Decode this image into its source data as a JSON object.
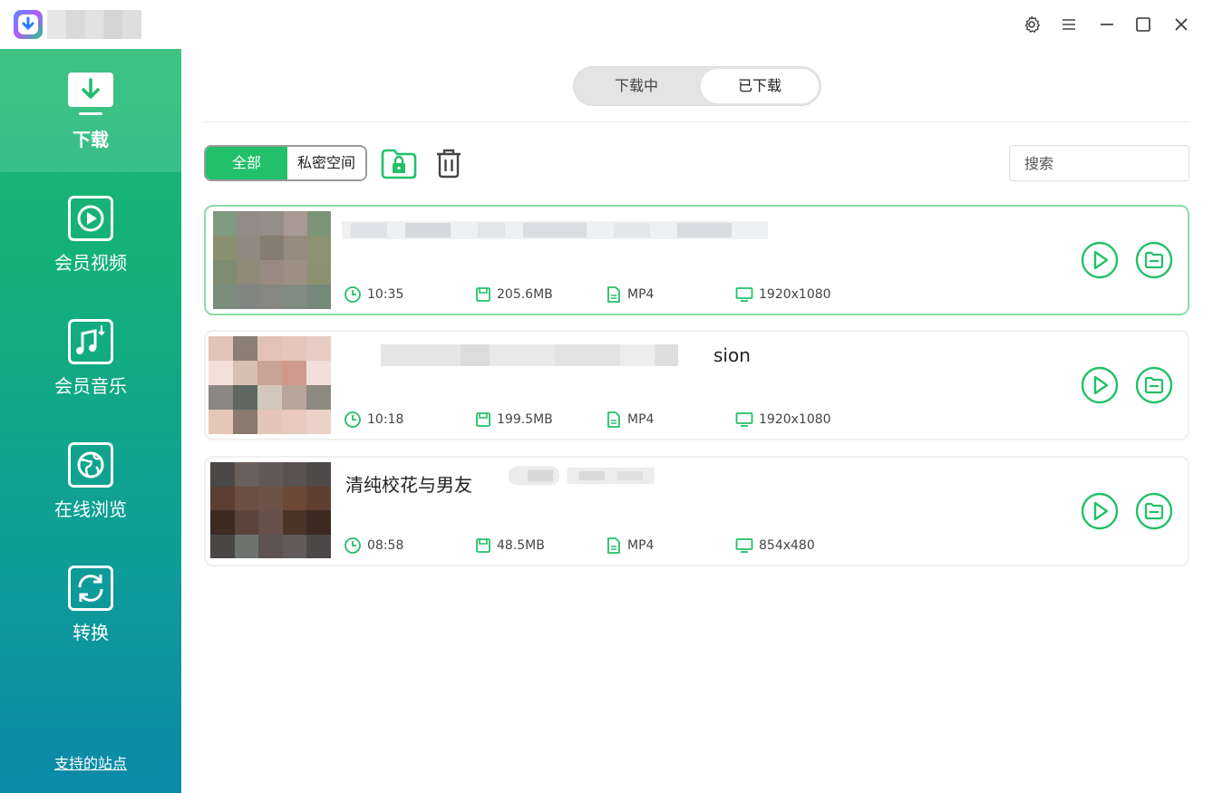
{
  "colors": {
    "accent": "#22c068",
    "sidebar_top": "#1fba6e",
    "sidebar_bottom": "#0b8aa8"
  },
  "sidebar": {
    "items": [
      {
        "label": "下载",
        "icon": "download-icon",
        "active": true
      },
      {
        "label": "会员视频",
        "icon": "play-circle-icon",
        "active": false
      },
      {
        "label": "会员音乐",
        "icon": "music-note-icon",
        "active": false
      },
      {
        "label": "在线浏览",
        "icon": "globe-icon",
        "active": false
      },
      {
        "label": "转换",
        "icon": "convert-icon",
        "active": false
      }
    ],
    "footer_link": "支持的站点"
  },
  "main": {
    "tabs": [
      {
        "label": "下载中",
        "selected": false
      },
      {
        "label": "已下载",
        "selected": true
      }
    ],
    "filter": {
      "all": "全部",
      "private": "私密空间"
    },
    "search_placeholder": "搜索",
    "items": [
      {
        "title": "",
        "duration": "10:35",
        "size": "205.6MB",
        "format": "MP4",
        "resolution": "1920x1080"
      },
      {
        "title": "sion",
        "duration": "10:18",
        "size": "199.5MB",
        "format": "MP4",
        "resolution": "1920x1080"
      },
      {
        "title": "清纯校花与男友",
        "duration": "08:58",
        "size": "48.5MB",
        "format": "MP4",
        "resolution": "854x480"
      }
    ]
  }
}
